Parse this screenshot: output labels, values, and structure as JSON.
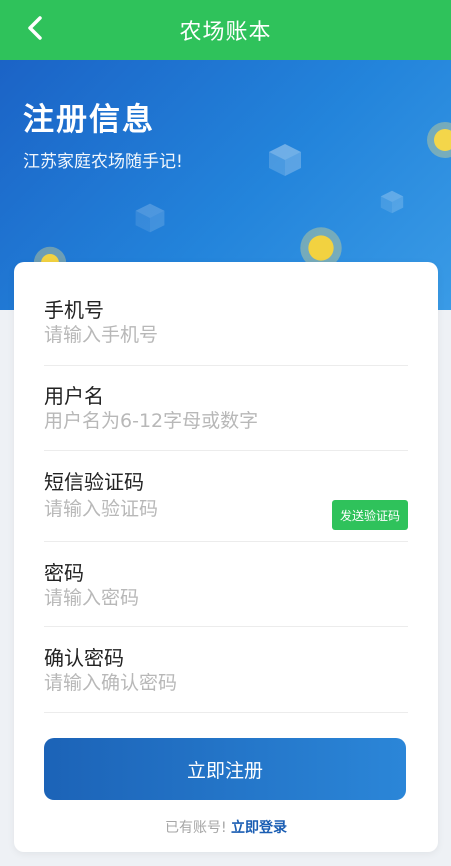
{
  "header": {
    "title": "农场账本",
    "back_icon": "chevron-left-icon",
    "background": "#2fc25b"
  },
  "hero": {
    "title": "注册信息",
    "subtitle": "江苏家庭农场随手记!"
  },
  "form": {
    "fields": [
      {
        "label": "手机号",
        "value": "",
        "placeholder": "请输入手机号"
      },
      {
        "label": "用户名",
        "value": "",
        "placeholder": "用户名为6-12字母或数字"
      },
      {
        "label": "短信验证码",
        "value": "",
        "placeholder": "请输入验证码"
      },
      {
        "label": "密码",
        "value": "",
        "placeholder": "请输入密码"
      },
      {
        "label": "确认密码",
        "value": "",
        "placeholder": "请输入确认密码"
      }
    ],
    "sms_button_label": "发送验证码",
    "submit_label": "立即注册",
    "login_hint": "已有账号!",
    "login_link": "立即登录"
  },
  "colors": {
    "accent_green": "#2fc25b",
    "accent_blue": "#1c63b7",
    "link": "#1b5eb3"
  }
}
